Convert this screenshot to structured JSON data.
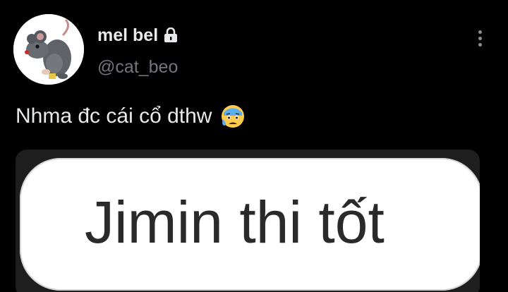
{
  "author": {
    "display_name": "mel bel",
    "handle": "@cat_beo",
    "avatar_icon": "rat-figurine-avatar",
    "protected_icon": "lock-icon"
  },
  "tweet": {
    "text": "Nhma đc cái cổ dthw",
    "emoji": "anxious-face-with-sweat",
    "media": {
      "text": "Jimin thi tốt"
    }
  },
  "menu": {
    "icon": "more-vertical-icon"
  },
  "colors": {
    "background": "#000000",
    "primary_text": "#e7e9ea",
    "secondary_text": "#71767b"
  }
}
